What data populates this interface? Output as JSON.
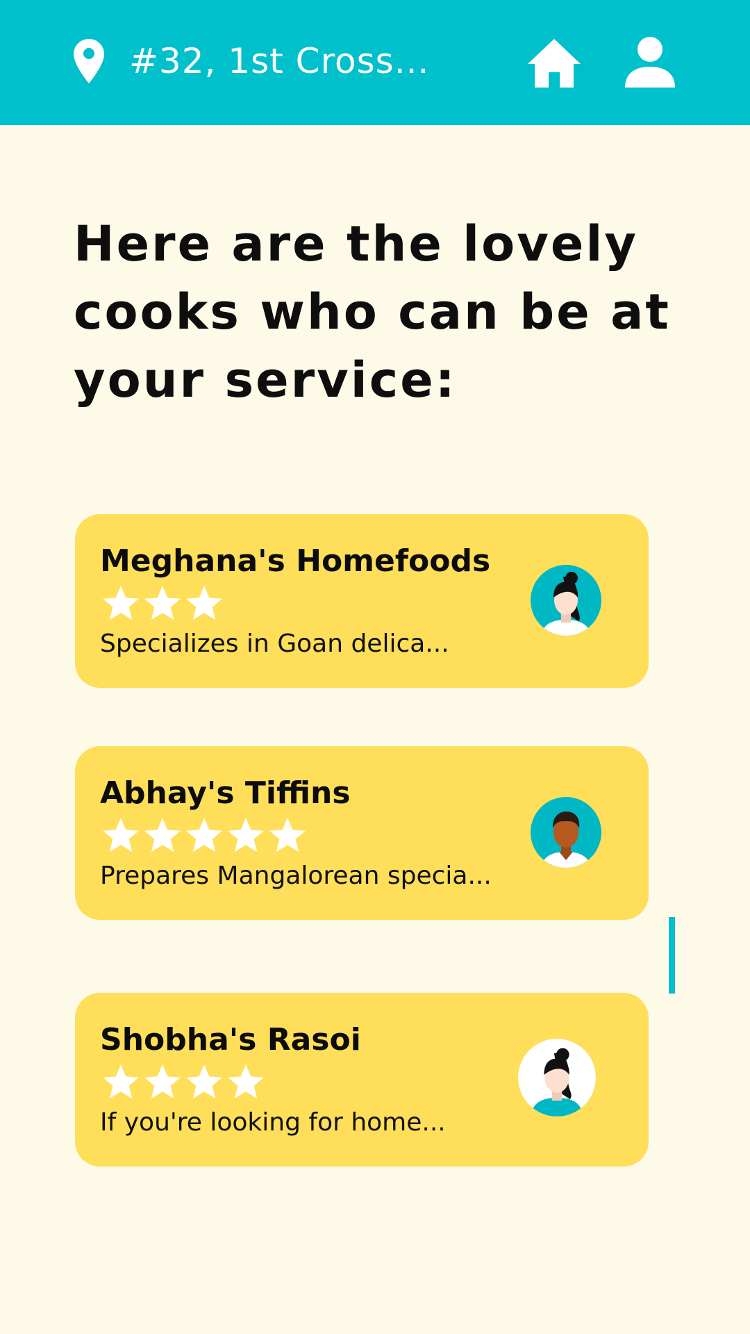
{
  "header": {
    "address": "#32, 1st Cross...",
    "location_icon": "map-pin-icon",
    "home_icon": "home-icon",
    "profile_icon": "user-icon"
  },
  "heading": {
    "line1": "Here are the lovely",
    "line2": "cooks who can be at",
    "line3": "your service:"
  },
  "cooks": [
    {
      "name": "Meghana's Homefoods",
      "rating": 3,
      "description": "Specializes in Goan delica...",
      "avatar_icon": "woman-avatar-icon"
    },
    {
      "name": "Abhay's Tiffins",
      "rating": 5,
      "description": "Prepares Mangalorean specia...",
      "avatar_icon": "man-avatar-icon"
    },
    {
      "name": "Shobha's Rasoi",
      "rating": 4,
      "description": "If you're looking for home...",
      "avatar_icon": "woman-avatar-icon"
    }
  ],
  "colors": {
    "header": "#00c0cc",
    "background": "#fefae8",
    "card": "#ffde5a",
    "star": "#ffffff",
    "text": "#0e0e0e"
  }
}
